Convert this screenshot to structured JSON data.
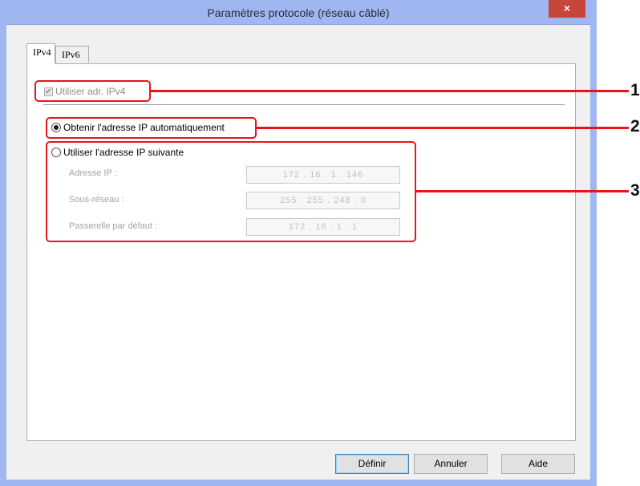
{
  "window": {
    "title": "Paramètres protocole (réseau câblé)",
    "close_glyph": "×"
  },
  "tabs": [
    {
      "label": "IPv4"
    },
    {
      "label": "IPv6"
    }
  ],
  "ipv4": {
    "use_ipv4_label": "Utiliser adr. IPv4",
    "use_ipv4_checked": true,
    "auto_label": "Obtenir l'adresse IP automatiquement",
    "auto_selected": true,
    "manual_label": "Utiliser l'adresse IP suivante",
    "manual_selected": false,
    "fields": [
      {
        "label": "Adresse IP :",
        "value": "172 . 16 . 1 . 146"
      },
      {
        "label": "Sous-réseau :",
        "value": "255 . 255 . 248 . 0"
      },
      {
        "label": "Passerelle par défaut :",
        "value": "172 . 16 . 1 . 1"
      }
    ]
  },
  "buttons": {
    "ok": "Définir",
    "cancel": "Annuler",
    "help": "Aide"
  },
  "callouts": {
    "one": "1",
    "two": "2",
    "three": "3"
  },
  "colors": {
    "highlight": "#e8141b",
    "titlebar": "#9fb6f0",
    "close": "#c7463b"
  }
}
